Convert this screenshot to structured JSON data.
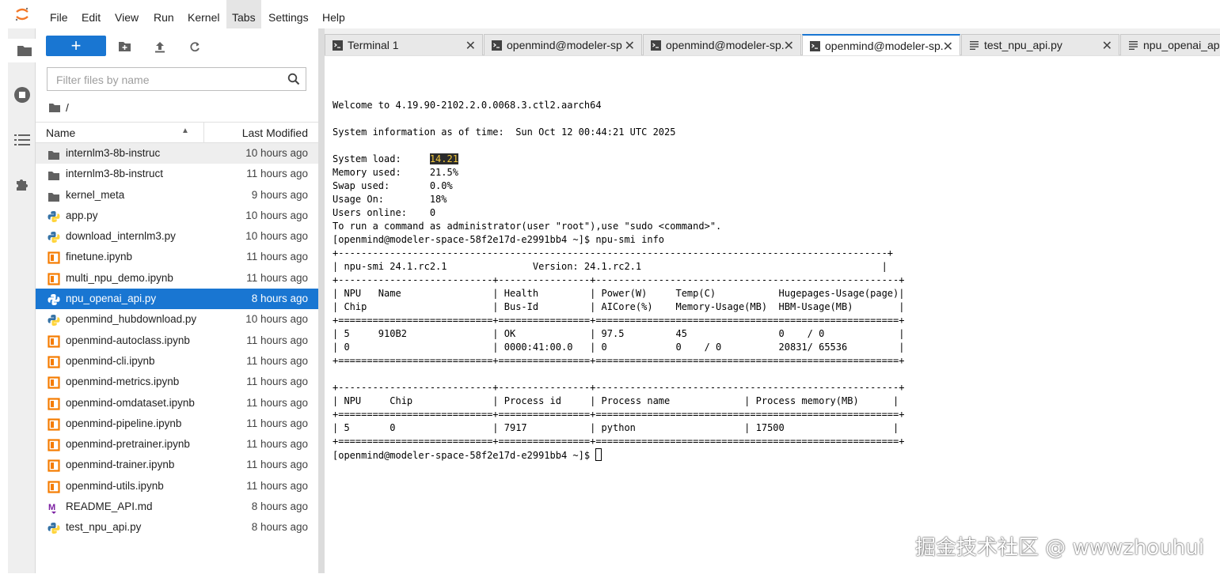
{
  "menu": [
    "File",
    "Edit",
    "View",
    "Run",
    "Kernel",
    "Tabs",
    "Settings",
    "Help"
  ],
  "menu_active": "Tabs",
  "filebrowser": {
    "new_label": "+",
    "filter_placeholder": "Filter files by name",
    "breadcrumb": "/",
    "col_name": "Name",
    "col_modified": "Last Modified",
    "files": [
      {
        "name": "internlm3-8b-instruc",
        "modified": "10 hours ago",
        "icon": "folder-icon",
        "state": "gray"
      },
      {
        "name": "internlm3-8b-instruct",
        "modified": "11 hours ago",
        "icon": "folder-icon",
        "state": ""
      },
      {
        "name": "kernel_meta",
        "modified": "9 hours ago",
        "icon": "folder-icon",
        "state": ""
      },
      {
        "name": "app.py",
        "modified": "10 hours ago",
        "icon": "python-icon",
        "state": ""
      },
      {
        "name": "download_internlm3.py",
        "modified": "10 hours ago",
        "icon": "python-icon",
        "state": ""
      },
      {
        "name": "finetune.ipynb",
        "modified": "11 hours ago",
        "icon": "notebook-icon",
        "state": ""
      },
      {
        "name": "multi_npu_demo.ipynb",
        "modified": "11 hours ago",
        "icon": "notebook-icon",
        "state": ""
      },
      {
        "name": "npu_openai_api.py",
        "modified": "8 hours ago",
        "icon": "python-icon",
        "state": "selected"
      },
      {
        "name": "openmind_hubdownload.py",
        "modified": "10 hours ago",
        "icon": "python-icon",
        "state": ""
      },
      {
        "name": "openmind-autoclass.ipynb",
        "modified": "11 hours ago",
        "icon": "notebook-icon",
        "state": ""
      },
      {
        "name": "openmind-cli.ipynb",
        "modified": "11 hours ago",
        "icon": "notebook-icon",
        "state": ""
      },
      {
        "name": "openmind-metrics.ipynb",
        "modified": "11 hours ago",
        "icon": "notebook-icon",
        "state": ""
      },
      {
        "name": "openmind-omdataset.ipynb",
        "modified": "11 hours ago",
        "icon": "notebook-icon",
        "state": ""
      },
      {
        "name": "openmind-pipeline.ipynb",
        "modified": "11 hours ago",
        "icon": "notebook-icon",
        "state": ""
      },
      {
        "name": "openmind-pretrainer.ipynb",
        "modified": "11 hours ago",
        "icon": "notebook-icon",
        "state": ""
      },
      {
        "name": "openmind-trainer.ipynb",
        "modified": "11 hours ago",
        "icon": "notebook-icon",
        "state": ""
      },
      {
        "name": "openmind-utils.ipynb",
        "modified": "11 hours ago",
        "icon": "notebook-icon",
        "state": ""
      },
      {
        "name": "README_API.md",
        "modified": "8 hours ago",
        "icon": "markdown-icon",
        "state": ""
      },
      {
        "name": "test_npu_api.py",
        "modified": "8 hours ago",
        "icon": "python-icon",
        "state": ""
      }
    ]
  },
  "tabs": [
    {
      "label": "Terminal 1",
      "icon": "terminal-icon",
      "active": false
    },
    {
      "label": "openmind@modeler-sp",
      "icon": "terminal-icon",
      "active": false
    },
    {
      "label": "openmind@modeler-sp.",
      "icon": "terminal-icon",
      "active": false
    },
    {
      "label": "openmind@modeler-sp.",
      "icon": "terminal-icon",
      "active": true
    },
    {
      "label": "test_npu_api.py",
      "icon": "file-icon",
      "active": false
    },
    {
      "label": "npu_openai_api.",
      "icon": "file-icon",
      "active": false
    }
  ],
  "terminal": {
    "welcome": "Welcome to 4.19.90-2102.2.0.0068.3.ctl2.aarch64",
    "sysinfo": "System information as of time:  Sun Oct 12 00:44:21 UTC 2025",
    "load_label": "System load:     ",
    "load_value": "14.21",
    "lines_after_load": [
      "Memory used:     21.5%",
      "Swap used:       0.0%",
      "Usage On:        18%",
      "Users online:    0",
      "To run a command as administrator(user \"root\"),use \"sudo <command>\".",
      "[openmind@modeler-space-58f2e17d-e2991bb4 ~]$ npu-smi info",
      "+------------------------------------------------------------------------------------------------+",
      "| npu-smi 24.1.rc2.1               Version: 24.1.rc2.1                                          |",
      "+---------------------------+----------------+-----------------------------------------------------+",
      "| NPU   Name                | Health         | Power(W)     Temp(C)           Hugepages-Usage(page)|",
      "| Chip                      | Bus-Id         | AICore(%)    Memory-Usage(MB)  HBM-Usage(MB)        |",
      "+===========================+================+=====================================================+",
      "| 5     910B2               | OK             | 97.5         45                0    / 0             |",
      "| 0                         | 0000:41:00.0   | 0            0    / 0          20831/ 65536         |",
      "+===========================+================+=====================================================+",
      "",
      "+---------------------------+----------------+-----------------------------------------------------+",
      "| NPU     Chip              | Process id     | Process name             | Process memory(MB)      |",
      "+===========================+================+=====================================================+",
      "| 5       0                 | 7917           | python                   | 17500                   |",
      "+===========================+================+=====================================================+"
    ],
    "prompt": "[openmind@modeler-space-58f2e17d-e2991bb4 ~]$ "
  },
  "watermark": "掘金技术社区 @ wwwzhouhui",
  "colors": {
    "accent": "#1976d2",
    "python_blue": "#3572A5",
    "python_yellow": "#FFD43B",
    "notebook_orange": "#f57c00",
    "markdown_purple": "#7b1fa2"
  }
}
